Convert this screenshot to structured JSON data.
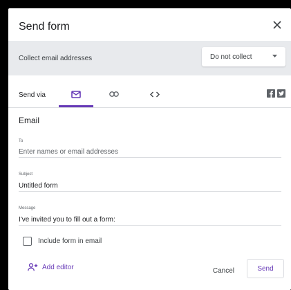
{
  "dialog": {
    "title": "Send form",
    "close_icon": "close-icon"
  },
  "collect": {
    "label": "Collect email addresses",
    "selected": "Do not collect"
  },
  "send_via": {
    "label": "Send via",
    "tabs": [
      {
        "name": "email",
        "icon": "mail-icon",
        "active": true
      },
      {
        "name": "link",
        "icon": "link-icon",
        "active": false
      },
      {
        "name": "embed",
        "icon": "embed-code-icon",
        "active": false
      }
    ],
    "social": [
      "facebook-icon",
      "twitter-icon"
    ]
  },
  "email": {
    "section_title": "Email",
    "to": {
      "label": "To",
      "value": "",
      "placeholder": "Enter names or email addresses"
    },
    "subject": {
      "label": "Subject",
      "value": "Untitled form"
    },
    "message": {
      "label": "Message",
      "value": "I've invited you to fill out a form:"
    },
    "include_label": "Include form in email",
    "include_checked": false
  },
  "footer": {
    "add_editor": "Add editor",
    "cancel": "Cancel",
    "send": "Send"
  },
  "colors": {
    "accent": "#673ab7",
    "band": "#e8eaed",
    "text": "#202124",
    "muted": "#5f6368"
  }
}
